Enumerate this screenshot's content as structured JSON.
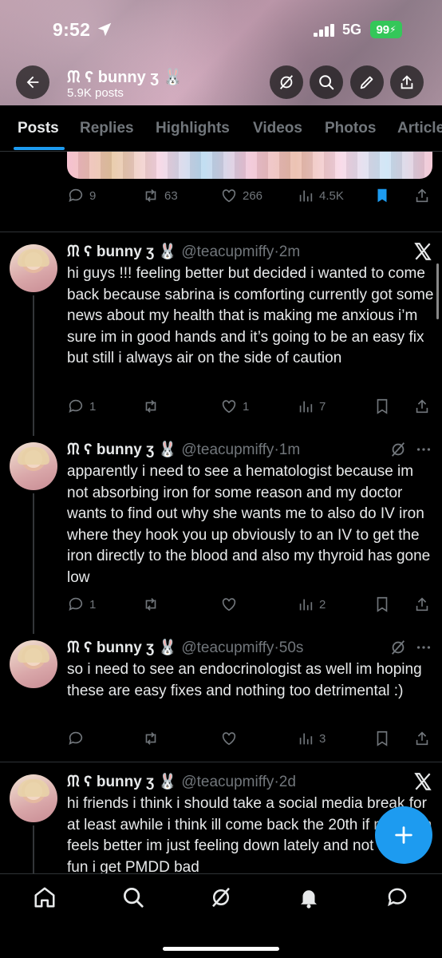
{
  "status": {
    "time": "9:52",
    "network": "5G",
    "battery": "99"
  },
  "profile": {
    "name": "ᙏ ʕ bunny ʒ 🐰",
    "posts": "5.9K posts"
  },
  "tabs": [
    "Posts",
    "Replies",
    "Highlights",
    "Videos",
    "Photos",
    "Articles"
  ],
  "prev_post": {
    "replies": "9",
    "reposts": "63",
    "likes": "266",
    "views": "4.5K"
  },
  "tweets": [
    {
      "name": "ᙏ ʕ bunny ʒ 🐰",
      "handle": "@teacupmiffy",
      "time": "2m",
      "text": "hi guys !!! feeling better but decided i wanted to come back because sabrina is comforting currently got some news about my health that is making me anxious i’m sure im in good hands and it’s going to be an easy fix but still i always air on the side of caution",
      "replies": "1",
      "reposts": "",
      "likes": "1",
      "views": "7",
      "corner": "x-logo-icon"
    },
    {
      "name": "ᙏ ʕ bunny ʒ 🐰",
      "handle": "@teacupmiffy",
      "time": "1m",
      "text": "apparently i need to see a hematologist because im not absorbing iron for some reason and my doctor wants to find out why she wants me to also do IV iron where they hook you up obviously to an IV to get the iron directly to the blood and also my thyroid has gone low",
      "replies": "1",
      "reposts": "",
      "likes": "",
      "views": "2",
      "corner": "grok-icon"
    },
    {
      "name": "ᙏ ʕ bunny ʒ 🐰",
      "handle": "@teacupmiffy",
      "time": "50s",
      "text": "so i need to see an endocrinologist as well im hoping these are easy fixes and nothing too detrimental :)",
      "replies": "",
      "reposts": "",
      "likes": "",
      "views": "3",
      "corner": "grok-icon"
    },
    {
      "name": "ᙏ ʕ bunny ʒ 🐰",
      "handle": "@teacupmiffy",
      "time": "2d",
      "text": "hi friends i think i should take a social media break for at least awhile i think ill come back the 20th if my brain feels better im just feeling down lately and not having fun i get PMDD bad",
      "corner": "x-logo-icon"
    }
  ],
  "colors": {
    "accent": "#1d9bf0",
    "muted": "#71767b",
    "text": "#e7e9ea",
    "background": "#000000"
  }
}
